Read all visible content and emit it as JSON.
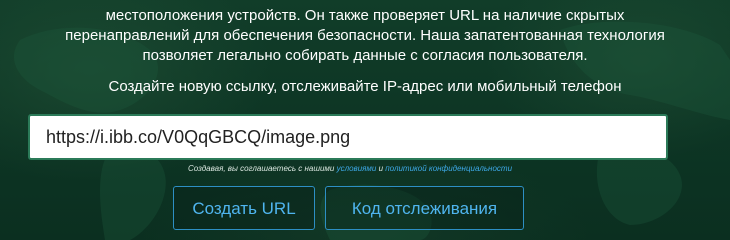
{
  "intro": {
    "lines": [
      "местоположения устройств. Он также проверяет URL на наличие скрытых",
      "перенаправлений для обеспечения безопасности. Наша запатентованная технология",
      "позволяет легально собирать данные с согласия пользователя."
    ]
  },
  "prompt": {
    "text": "Создайте новую ссылку, отслеживайте IP-адрес или мобильный телефон"
  },
  "url_input": {
    "value": "https://i.ibb.co/V0QqGBCQ/image.png"
  },
  "terms": {
    "prefix": "Создавая, вы соглашаетесь с нашими ",
    "conditions_link": "условиями",
    "middle": " и ",
    "privacy_link": "политикой конфиденциальности"
  },
  "buttons": {
    "create_label": "Создать URL",
    "tracking_label": "Код отслеживания"
  },
  "colors": {
    "background": "#0d3524",
    "button_accent": "#4fb5ef",
    "link": "#3da8e6",
    "input_border": "#2b7a58"
  }
}
